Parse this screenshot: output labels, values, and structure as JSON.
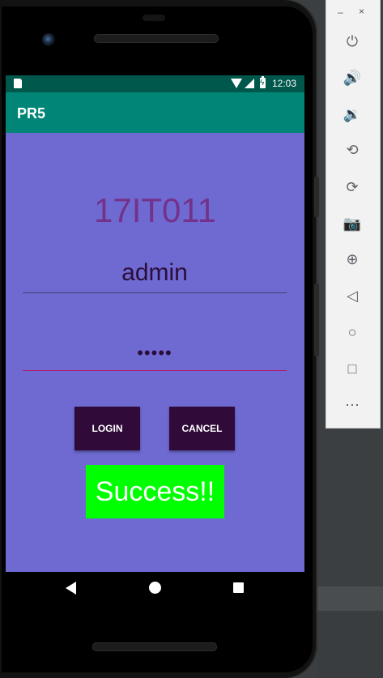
{
  "status_bar": {
    "time": "12:03"
  },
  "app_bar": {
    "title": "PR5"
  },
  "form": {
    "heading": "17IT011",
    "username_value": "admin",
    "password_value": "•••••",
    "login_label": "LOGIN",
    "cancel_label": "CANCEL",
    "result_text": "Success!!"
  },
  "emulator_panel": {
    "window_controls": {
      "minimize": "–",
      "close": "×"
    },
    "tools": [
      {
        "name": "power-icon",
        "glyph": "⏻"
      },
      {
        "name": "volume-up-icon",
        "glyph": "🔊"
      },
      {
        "name": "volume-down-icon",
        "glyph": "🔉"
      },
      {
        "name": "rotate-left-icon",
        "glyph": "⟲"
      },
      {
        "name": "rotate-right-icon",
        "glyph": "⟳"
      },
      {
        "name": "camera-icon",
        "glyph": "📷"
      },
      {
        "name": "zoom-icon",
        "glyph": "⊕"
      },
      {
        "name": "back-icon",
        "glyph": "◁"
      },
      {
        "name": "home-icon",
        "glyph": "○"
      },
      {
        "name": "overview-icon",
        "glyph": "□"
      },
      {
        "name": "more-icon",
        "glyph": "⋯"
      }
    ]
  },
  "colors": {
    "status_bar": "#00574b",
    "app_bar": "#008577",
    "content_bg": "#6f6ad1",
    "heading": "#74318a",
    "button_bg": "#300a38",
    "success_bg": "#00ff00",
    "password_underline": "#b8156a"
  }
}
